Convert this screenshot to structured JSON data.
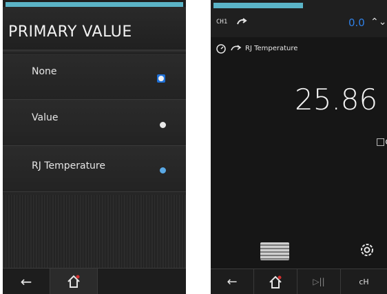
{
  "left": {
    "title": "PRIMARY VALUE",
    "options": [
      {
        "label": "None",
        "state": "selected"
      },
      {
        "label": "Value",
        "state": "unselected"
      },
      {
        "label": "RJ Temperature",
        "state": "highlighted"
      }
    ],
    "nav": {
      "back_icon": "←",
      "home_icon": "⌂"
    }
  },
  "right": {
    "channel_label": "CH1",
    "channel_value": "0.0",
    "channel_arrows": "⌃⌄",
    "sub_label": "RJ Temperature",
    "main_value": "25.86",
    "unit": "□c",
    "nav": {
      "back_icon": "←",
      "home_icon": "⌂",
      "play_pause_icon": "▷||",
      "channel_icon": "cH"
    }
  },
  "colors": {
    "accent": "#5bb4c7",
    "value_blue": "#2f80e6",
    "select_blue": "#1e6fd6"
  }
}
